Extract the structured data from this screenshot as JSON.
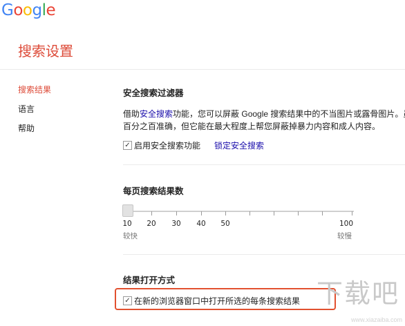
{
  "logo": {
    "letters": [
      "G",
      "o",
      "o",
      "g",
      "l",
      "e"
    ],
    "colors": [
      "#4285f4",
      "#ea4335",
      "#fbbc05",
      "#4285f4",
      "#34a853",
      "#ea4335"
    ]
  },
  "page_title": "搜索设置",
  "sidebar": {
    "items": [
      {
        "label": "搜索结果",
        "active": true
      },
      {
        "label": "语言",
        "active": false
      },
      {
        "label": "帮助",
        "active": false
      }
    ]
  },
  "safe_search": {
    "title": "安全搜索过滤器",
    "desc_prefix": "借助",
    "desc_link": "安全搜索",
    "desc_suffix": "功能，您可以屏蔽 Google 搜索结果中的不当图片或露骨图片。虽",
    "desc_line2": "百分之百准确，但它能在最大程度上帮您屏蔽掉暴力内容和成人内容。",
    "checkbox_label": "启用安全搜索功能",
    "checkbox_checked": true,
    "lock_link": "锁定安全搜索"
  },
  "results_per_page": {
    "title": "每页搜索结果数",
    "ticks": [
      "10",
      "20",
      "30",
      "40",
      "50",
      "100"
    ],
    "selected": "10",
    "left_label": "较快",
    "right_label": "较慢"
  },
  "open_results": {
    "title": "结果打开方式",
    "checkbox_label": "在新的浏览器窗口中打开所选的每条搜索结果",
    "checkbox_checked": true
  },
  "watermark": {
    "main": "下载吧",
    "sub": "www.xiazaiba.com"
  },
  "colors": {
    "accent": "#dd4b39",
    "link": "#1a0dab",
    "highlight": "#e2502f"
  }
}
